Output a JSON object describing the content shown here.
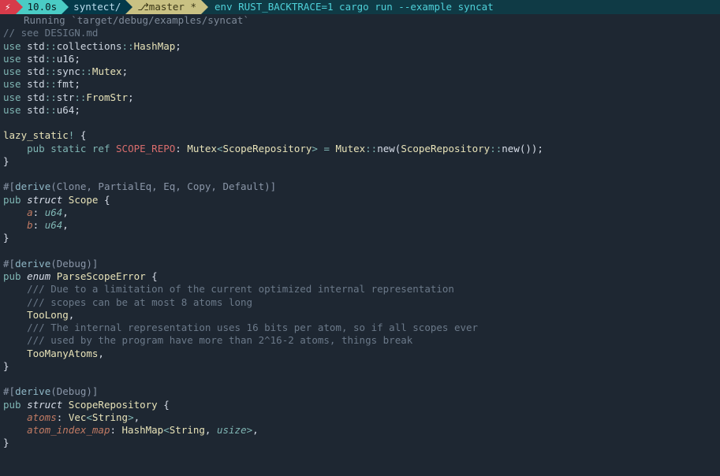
{
  "prompt": {
    "bolt": "⚡",
    "time": "10.0s",
    "dir": "syntect/",
    "branch_icon": "⎇",
    "branch": "master *",
    "command": "env RUST_BACKTRACE=1 cargo run --example syncat"
  },
  "running_line": "Running `target/debug/examples/syncat`",
  "code": {
    "l01": "// see DESIGN.md",
    "l02_use": "use",
    "l02_a": " std",
    "l02_b": "::",
    "l02_c": "collections",
    "l02_d": "::",
    "l02_e": "HashMap",
    "l02_f": ";",
    "l03_use": "use",
    "l03_a": " std",
    "l03_b": "::",
    "l03_c": "u16",
    "l03_d": ";",
    "l04_use": "use",
    "l04_a": " std",
    "l04_b": "::",
    "l04_c": "sync",
    "l04_d": "::",
    "l04_e": "Mutex",
    "l04_f": ";",
    "l05_use": "use",
    "l05_a": " std",
    "l05_b": "::",
    "l05_c": "fmt",
    "l05_d": ";",
    "l06_use": "use",
    "l06_a": " std",
    "l06_b": "::",
    "l06_c": "str",
    "l06_d": "::",
    "l06_e": "FromStr",
    "l06_f": ";",
    "l07_use": "use",
    "l07_a": " std",
    "l07_b": "::",
    "l07_c": "u64",
    "l07_d": ";",
    "l09_a": "lazy_static",
    "l09_b": "!",
    "l09_c": " {",
    "l10_a": "    ",
    "l10_pub": "pub",
    "l10_sp1": " ",
    "l10_static": "static",
    "l10_sp2": " ",
    "l10_ref": "ref",
    "l10_sp3": " ",
    "l10_name": "SCOPE_REPO",
    "l10_colon": ": ",
    "l10_t1": "Mutex",
    "l10_lt": "<",
    "l10_t2": "ScopeRepository",
    "l10_gt": ">",
    "l10_eq": " = ",
    "l10_t3": "Mutex",
    "l10_cc": "::",
    "l10_new": "new",
    "l10_p1": "(",
    "l10_t4": "ScopeRepository",
    "l10_cc2": "::",
    "l10_new2": "new",
    "l10_p2": "());",
    "l11": "}",
    "l13_a": "#[",
    "l13_b": "derive",
    "l13_c": "(Clone, PartialEq, Eq, Copy, Default)]",
    "l14_pub": "pub",
    "l14_sp": " ",
    "l14_struct": "struct",
    "l14_sp2": " ",
    "l14_name": "Scope",
    "l14_b": " {",
    "l15_a": "    ",
    "l15_f": "a",
    "l15_c": ": ",
    "l15_t": "u64",
    "l15_e": ",",
    "l16_a": "    ",
    "l16_f": "b",
    "l16_c": ": ",
    "l16_t": "u64",
    "l16_e": ",",
    "l17": "}",
    "l19_a": "#[",
    "l19_b": "derive",
    "l19_c": "(Debug)]",
    "l20_pub": "pub",
    "l20_sp": " ",
    "l20_enum": "enum",
    "l20_sp2": " ",
    "l20_name": "ParseScopeError",
    "l20_b": " {",
    "l21": "    /// Due to a limitation of the current optimized internal representation",
    "l22": "    /// scopes can be at most 8 atoms long",
    "l23_a": "    ",
    "l23_b": "TooLong",
    "l23_c": ",",
    "l24": "    /// The internal representation uses 16 bits per atom, so if all scopes ever",
    "l25": "    /// used by the program have more than 2^16-2 atoms, things break",
    "l26_a": "    ",
    "l26_b": "TooManyAtoms",
    "l26_c": ",",
    "l27": "}",
    "l29_a": "#[",
    "l29_b": "derive",
    "l29_c": "(Debug)]",
    "l30_pub": "pub",
    "l30_sp": " ",
    "l30_struct": "struct",
    "l30_sp2": " ",
    "l30_name": "ScopeRepository",
    "l30_b": " {",
    "l31_a": "    ",
    "l31_f": "atoms",
    "l31_c": ": ",
    "l31_t1": "Vec",
    "l31_lt": "<",
    "l31_t2": "String",
    "l31_gt": ">",
    "l31_e": ",",
    "l32_a": "    ",
    "l32_f": "atom_index_map",
    "l32_c": ": ",
    "l32_t1": "HashMap",
    "l32_lt": "<",
    "l32_t2": "String",
    "l32_cm": ", ",
    "l32_t3": "usize",
    "l32_gt": ">",
    "l32_e": ",",
    "l33": "}"
  }
}
